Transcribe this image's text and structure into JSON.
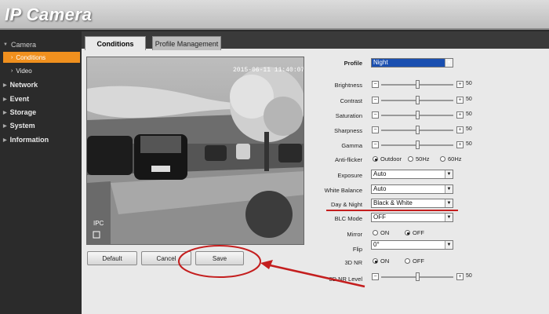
{
  "app": {
    "title": "IP Camera"
  },
  "sidebar": {
    "items": [
      {
        "label": "Camera",
        "expanded": true
      },
      {
        "label": "Conditions",
        "active": true
      },
      {
        "label": "Video"
      },
      {
        "label": "Network"
      },
      {
        "label": "Event"
      },
      {
        "label": "Storage"
      },
      {
        "label": "System"
      },
      {
        "label": "Information"
      }
    ]
  },
  "tabs": [
    {
      "label": "Conditions",
      "active": true
    },
    {
      "label": "Profile Management",
      "active": false
    }
  ],
  "video": {
    "timestamp": "2015-06-11 11:40:07",
    "watermark": "IPC"
  },
  "buttons": {
    "default": "Default",
    "cancel": "Cancel",
    "save": "Save"
  },
  "settings": {
    "profile": {
      "label": "Profile",
      "value": "Night"
    },
    "brightness": {
      "label": "Brightness",
      "value": "50",
      "level": 50
    },
    "contrast": {
      "label": "Contrast",
      "value": "50",
      "level": 50
    },
    "saturation": {
      "label": "Saturation",
      "value": "50",
      "level": 50
    },
    "sharpness": {
      "label": "Sharpness",
      "value": "50",
      "level": 50
    },
    "gamma": {
      "label": "Gamma",
      "value": "50",
      "level": 50
    },
    "antiflicker": {
      "label": "Anti-flicker",
      "options": [
        "Outdoor",
        "50Hz",
        "60Hz"
      ],
      "selected": "Outdoor"
    },
    "exposure": {
      "label": "Exposure",
      "value": "Auto"
    },
    "white_balance": {
      "label": "White Balance",
      "value": "Auto"
    },
    "day_night": {
      "label": "Day & Night",
      "value": "Black & White"
    },
    "blc_mode": {
      "label": "BLC Mode",
      "value": "OFF"
    },
    "mirror": {
      "label": "Mirror",
      "options": [
        "ON",
        "OFF"
      ],
      "selected": "OFF"
    },
    "flip": {
      "label": "Flip",
      "value": "0°"
    },
    "nr3d": {
      "label": "3D NR",
      "options": [
        "ON",
        "OFF"
      ],
      "selected": "ON"
    },
    "nr3d_level": {
      "label": "3D NR Level",
      "value": "50",
      "level": 50
    }
  },
  "colors": {
    "accent": "#f0901e",
    "annotation": "#c41e1e",
    "highlight": "#1a4fb0"
  }
}
